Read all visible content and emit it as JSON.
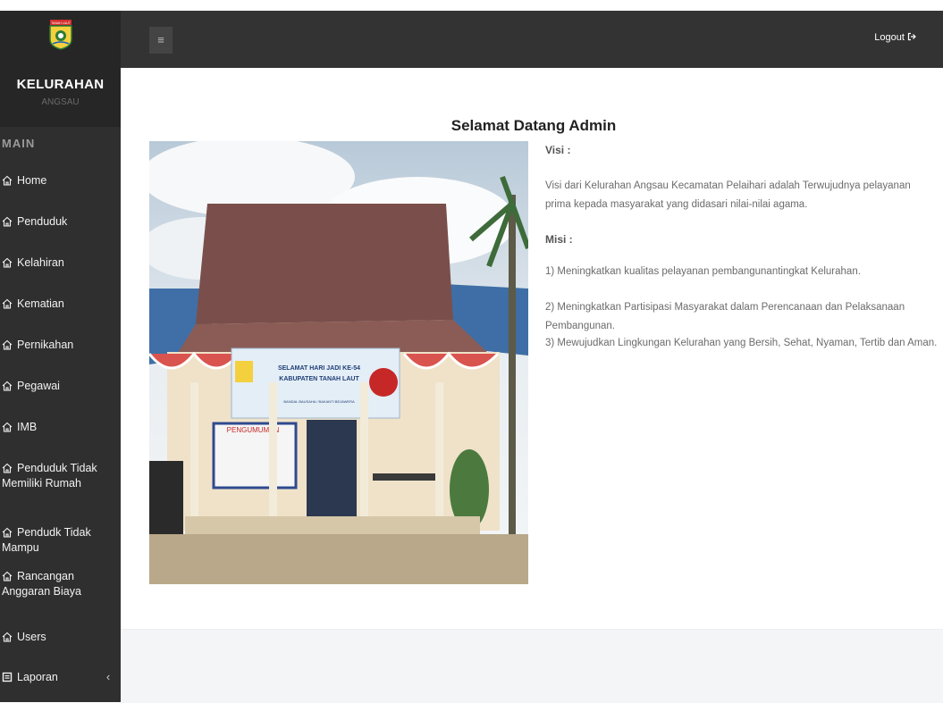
{
  "sidebar": {
    "logo_text": "TANAH LAUT",
    "title": "KELURAHAN",
    "subtitle": "ANGSAU",
    "section": "MAIN",
    "items": [
      {
        "label": "Home"
      },
      {
        "label": "Penduduk"
      },
      {
        "label": "Kelahiran"
      },
      {
        "label": "Kematian"
      },
      {
        "label": "Pernikahan"
      },
      {
        "label": "Pegawai"
      },
      {
        "label": "IMB"
      },
      {
        "label": "Penduduk Tidak Memiliki Rumah"
      },
      {
        "label": "Pendudk Tidak Mampu"
      },
      {
        "label": "Rancangan Anggaran Biaya"
      },
      {
        "label": "Users"
      },
      {
        "label": "Laporan",
        "arrow": "‹"
      }
    ]
  },
  "topbar": {
    "toggle_icon": "≡",
    "logout_label": "Logout"
  },
  "main": {
    "title": "Selamat Datang Admin",
    "visi_label": "Visi :",
    "visi_text": "Visi dari Kelurahan Angsau Kecamatan Pelaihari adalah Terwujudnya pelayanan prima kepada masyarakat yang didasari nilai-nilai agama.",
    "misi_label": "Misi :",
    "misi": [
      "1) Meningkatkan kualitas pelayanan pembangunantingkat Kelurahan.",
      "2) Meningkatkan Partisipasi Masyarakat dalam Perencanaan dan Pelaksanaan Pembangunan.",
      "3) Mewujudkan Lingkungan Kelurahan yang Bersih, Sehat, Nyaman, Tertib dan Aman."
    ],
    "banner": {
      "line1": "SELAMAT HARI JADI KE-54",
      "line2": "KABUPATEN TANAH LAUT",
      "line3": "BANDAL BAUSAHA / BAKANTI BEJAWERA"
    },
    "board_label": "PENGUMUMAN"
  }
}
